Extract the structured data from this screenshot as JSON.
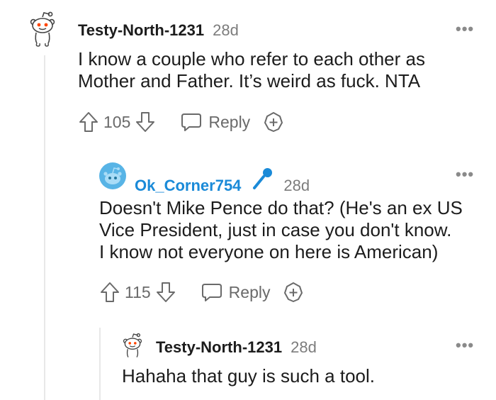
{
  "comments": [
    {
      "username": "Testy-North-1231",
      "age": "28d",
      "lines": [
        "I know a couple who refer to each other as",
        "Mother and Father. It’s weird as fuck. NTA"
      ],
      "votes": "105",
      "reply_label": "Reply",
      "more": "•••"
    },
    {
      "username": "Ok_Corner754",
      "age": "28d",
      "lines": [
        "Doesn't Mike Pence do that? (He's an ex US",
        "Vice President, just in case you don't know.",
        "I know not everyone on here is American)"
      ],
      "votes": "115",
      "reply_label": "Reply",
      "more": "•••"
    },
    {
      "username": "Testy-North-1231",
      "age": "28d",
      "lines": [
        "Hahaha that guy is such a tool."
      ],
      "more": "•••"
    }
  ],
  "icons": {
    "avatar1": "snoo-avatar-icon",
    "avatar2": "snoo-blue-avatar-icon",
    "mic": "microphone-icon",
    "upvote": "upvote-arrow-icon",
    "downvote": "downvote-arrow-icon",
    "reply": "chat-bubble-icon",
    "award": "award-plus-icon"
  },
  "colors": {
    "link_blue": "#1a8ad8",
    "snoo_orange": "#ff4500",
    "meta_gray": "#7c7c7c"
  }
}
